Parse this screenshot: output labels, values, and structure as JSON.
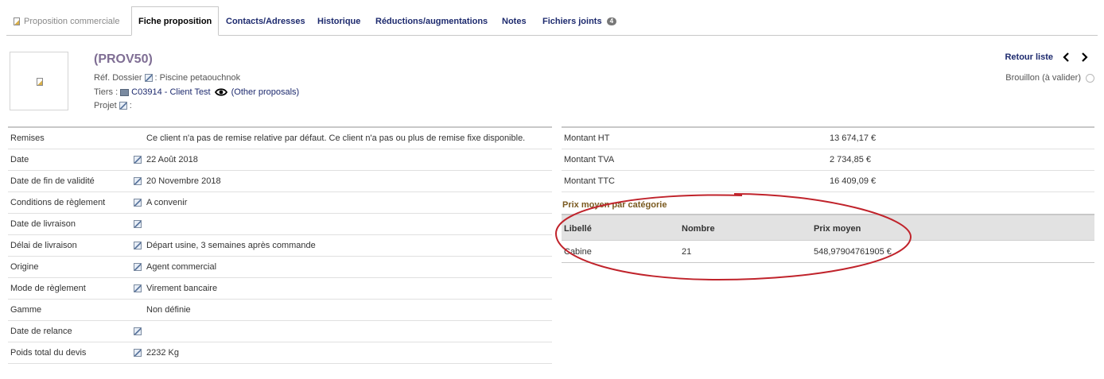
{
  "tabs": {
    "items": [
      {
        "label": "Proposition commerciale"
      },
      {
        "label": "Fiche proposition"
      },
      {
        "label": "Contacts/Adresses"
      },
      {
        "label": "Historique"
      },
      {
        "label": "Réductions/augmentations"
      },
      {
        "label": "Notes"
      },
      {
        "label": "Fichiers joints",
        "count": "4"
      }
    ],
    "active": "Fiche proposition"
  },
  "header": {
    "ref": "(PROV50)",
    "ref_dossier_label": "Réf. Dossier",
    "ref_dossier_value": ": Piscine petaouchnok",
    "tiers_label": "Tiers :",
    "tiers_value": "C03914 - Client Test",
    "other_proposals": "(Other proposals)",
    "projet_label": "Projet",
    "projet_value": ":"
  },
  "nav": {
    "back_label": "Retour liste",
    "prev_icon": "chevron-left-icon",
    "next_icon": "chevron-right-icon"
  },
  "status": {
    "label": "Brouillon (à valider)"
  },
  "fields": [
    {
      "label": "Remises",
      "value": "Ce client n'a pas de remise relative par défaut. Ce client n'a pas ou plus de remise fixe disponible.",
      "editable": false
    },
    {
      "label": "Date",
      "value": "22 Août 2018",
      "editable": true
    },
    {
      "label": "Date de fin de validité",
      "value": "20 Novembre 2018",
      "editable": true
    },
    {
      "label": "Conditions de règlement",
      "value": "A convenir",
      "editable": true
    },
    {
      "label": "Date de livraison",
      "value": "",
      "editable": true
    },
    {
      "label": "Délai de livraison",
      "value": "Départ usine, 3 semaines après commande",
      "editable": true
    },
    {
      "label": "Origine",
      "value": "Agent commercial",
      "editable": true
    },
    {
      "label": "Mode de règlement",
      "value": "Virement bancaire",
      "editable": true
    },
    {
      "label": "Gamme",
      "value": "Non définie",
      "editable": false
    },
    {
      "label": "Date de relance",
      "value": "",
      "editable": true
    },
    {
      "label": "Poids total du devis",
      "value": "2232 Kg",
      "editable": true
    }
  ],
  "amounts": [
    {
      "label": "Montant HT",
      "value": "13 674,17 €"
    },
    {
      "label": "Montant TVA",
      "value": "2 734,85 €"
    },
    {
      "label": "Montant TTC",
      "value": "16 409,09 €"
    }
  ],
  "price_by_category": {
    "title": "Prix moyen par catégorie",
    "columns": [
      "Libellé",
      "Nombre",
      "Prix moyen"
    ],
    "rows": [
      [
        "Cabine",
        "21",
        "548,97904761905 €"
      ]
    ]
  },
  "colors": {
    "link": "#1d2a6e",
    "ref_title": "#7f6e94",
    "section_title": "#7a5a20",
    "annotation": "#c0232b"
  }
}
